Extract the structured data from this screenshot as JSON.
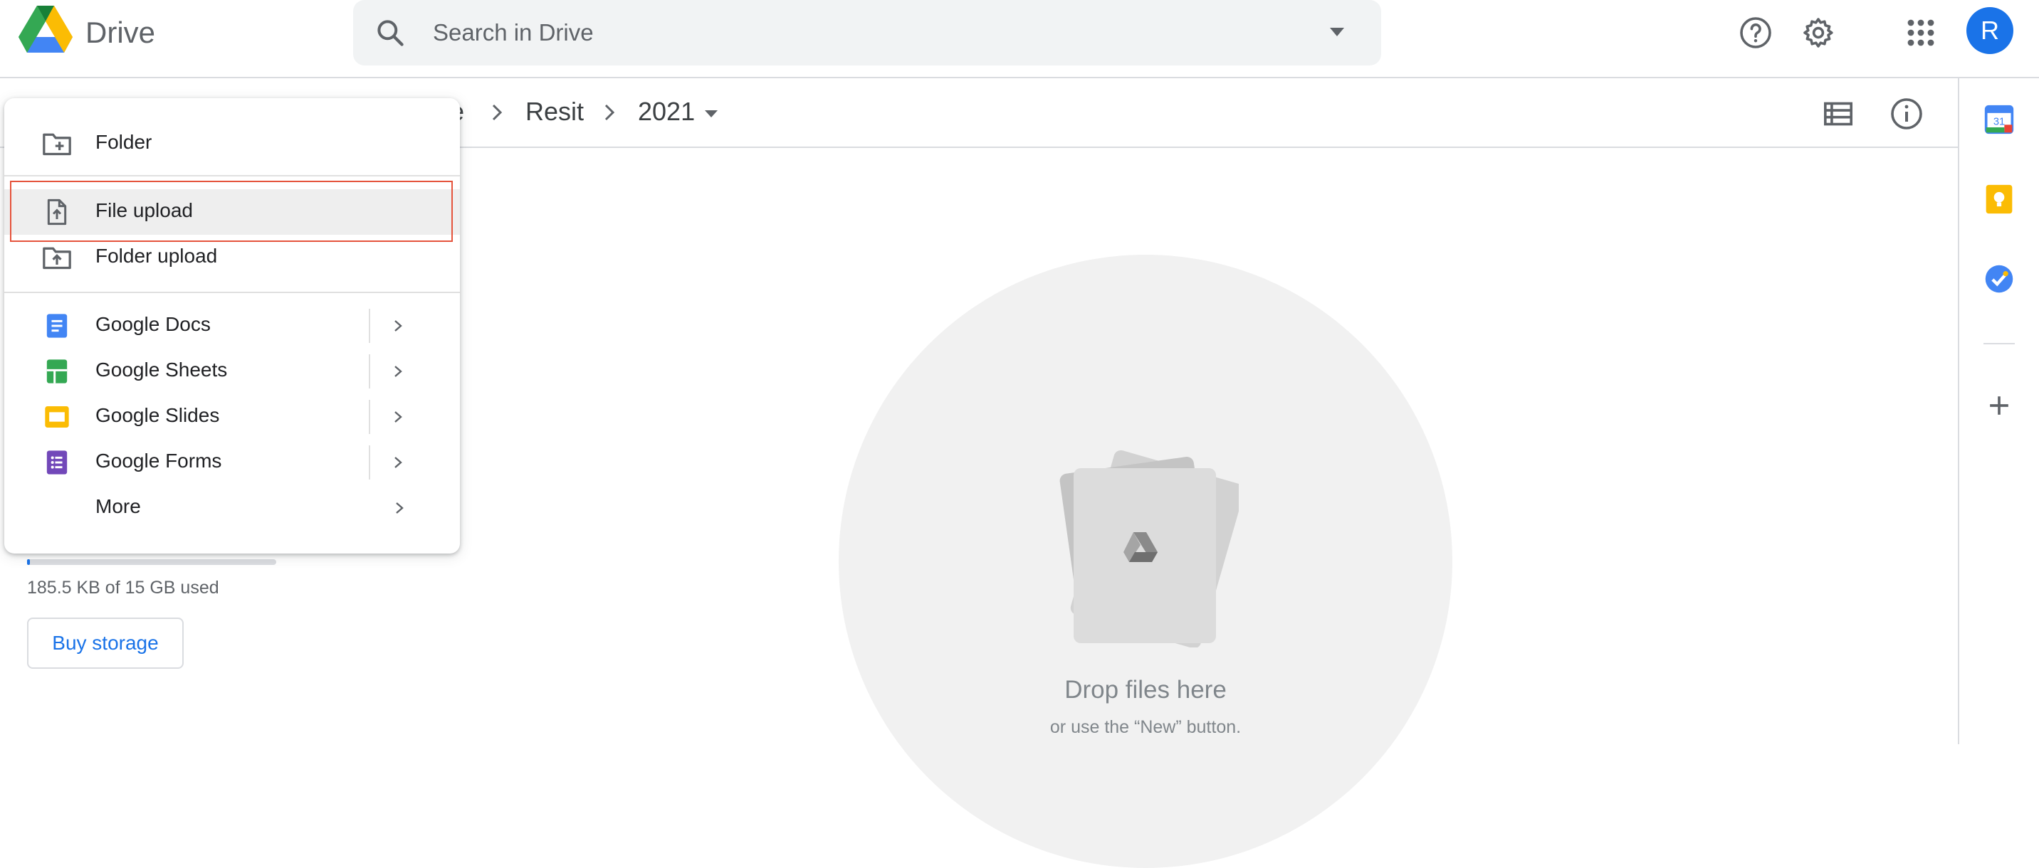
{
  "app": {
    "title": "Drive"
  },
  "search": {
    "placeholder": "Search in Drive"
  },
  "header": {
    "avatar_initial": "R"
  },
  "breadcrumb": {
    "items": [
      {
        "label": "e"
      },
      {
        "label": "Resit"
      },
      {
        "label": "2021"
      }
    ]
  },
  "new_menu": {
    "items": [
      {
        "label": "Folder",
        "icon": "new-folder-icon"
      },
      {
        "label": "File upload",
        "icon": "file-upload-icon"
      },
      {
        "label": "Folder upload",
        "icon": "folder-upload-icon"
      },
      {
        "label": "Google Docs",
        "icon": "google-docs-icon"
      },
      {
        "label": "Google Sheets",
        "icon": "google-sheets-icon"
      },
      {
        "label": "Google Slides",
        "icon": "google-slides-icon"
      },
      {
        "label": "Google Forms",
        "icon": "google-forms-icon"
      },
      {
        "label": "More",
        "icon": ""
      }
    ]
  },
  "storage": {
    "used_text": "185.5 KB of 15 GB used",
    "buy_label": "Buy storage",
    "used_fraction": 0.012
  },
  "drop_zone": {
    "title": "Drop files here",
    "subtitle": "or use the “New” button."
  },
  "colors": {
    "accent": "#1a73e8",
    "highlight_border": "#e5533c",
    "docs": "#4285f4",
    "sheets": "#34a853",
    "slides": "#fbbc04",
    "forms": "#7248b9"
  }
}
